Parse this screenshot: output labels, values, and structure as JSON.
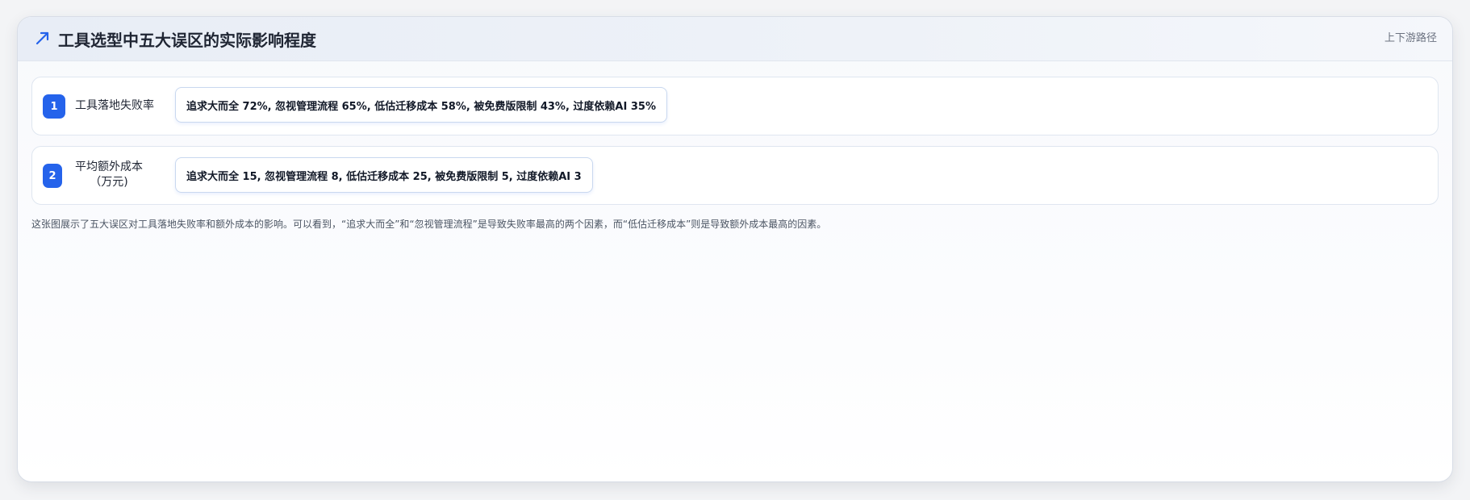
{
  "header": {
    "icon": "trend-arrow-icon",
    "title": "工具选型中五大误区的实际影响程度",
    "link_label": "上下游路径"
  },
  "colors": {
    "accent": "#2563eb",
    "title": "#1f2533",
    "muted": "#6b7280"
  },
  "rows": [
    {
      "index": "1",
      "label": "工具落地失败率",
      "values_text": "追求大而全 72%, 忽视管理流程 65%, 低估迁移成本 58%, 被免费版限制 43%, 过度依赖AI 35%"
    },
    {
      "index": "2",
      "label": "平均额外成本（万元)",
      "values_text": "追求大而全 15, 忽视管理流程 8, 低估迁移成本 25, 被免费版限制 5, 过度依赖AI 3"
    }
  ],
  "description": "这张图展示了五大误区对工具落地失败率和额外成本的影响。可以看到，“追求大而全”和“忽视管理流程”是导致失败率最高的两个因素，而“低估迁移成本”则是导致额外成本最高的因素。"
}
